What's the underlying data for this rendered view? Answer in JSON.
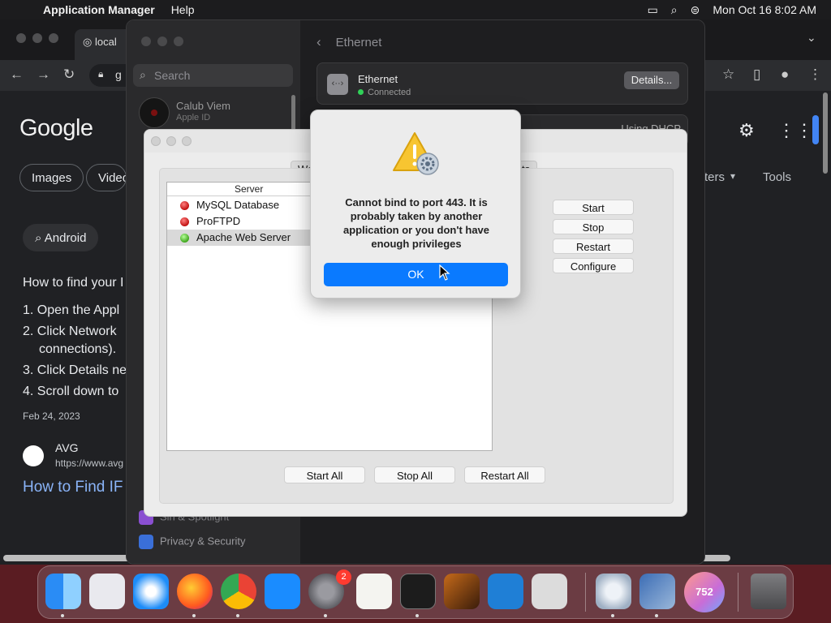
{
  "menubar": {
    "app_name": "Application Manager",
    "help": "Help",
    "datetime": "Mon Oct 16  8:02 AM"
  },
  "chrome": {
    "tab_title": "local",
    "omnibox_text": "g",
    "logo": "Google",
    "chips": [
      "Images",
      "Video",
      "Android"
    ],
    "tools": "Tools",
    "filters_partial": "ters",
    "heading": "How to find your I",
    "steps": [
      "1. Open the Appl",
      "2. Click Network",
      "connections).",
      "3. Click Details ne",
      "4. Scroll down to"
    ],
    "date": "Feb 24, 2023",
    "source_name": "AVG",
    "source_url": "https://www.avg",
    "result_link": "How to Find IF"
  },
  "settings": {
    "search_placeholder": "Search",
    "user_name": "Calub Viem",
    "user_sub": "Apple ID",
    "sidebar_items": [
      "Siri & Spotlight",
      "Privacy & Security"
    ],
    "header": "Ethernet",
    "eth_title": "Ethernet",
    "eth_status": "Connected",
    "details_button": "Details...",
    "dhcp": "Using DHCP"
  },
  "manager": {
    "tab_left_partial": "We",
    "tab_right_partial": "ts",
    "server_header": "Server",
    "servers": [
      {
        "name": "MySQL Database",
        "status": "stopped"
      },
      {
        "name": "ProFTPD",
        "status": "stopped"
      },
      {
        "name": "Apache Web Server",
        "status": "running"
      }
    ],
    "buttons": {
      "start": "Start",
      "stop": "Stop",
      "restart": "Restart",
      "configure": "Configure",
      "start_all": "Start All",
      "stop_all": "Stop All",
      "restart_all": "Restart All"
    }
  },
  "alert": {
    "message": "Cannot bind to port 443. It is probably taken by another application or you don't have enough privileges",
    "ok": "OK",
    "icon": "warning-icon"
  },
  "dock": {
    "items": [
      "finder",
      "launchpad",
      "safari",
      "firefox",
      "chrome",
      "app-store",
      "system-settings",
      "textedit",
      "terminal",
      "garageband",
      "vscode",
      "roblox",
      "xampp-manager",
      "virtualbox",
      "counter-app",
      "trash"
    ],
    "settings_badge": "2",
    "counter_value": "752"
  },
  "colors": {
    "accent": "#0a7aff",
    "running": "#3ea51c",
    "stopped": "#c01010",
    "connected": "#30d158"
  }
}
